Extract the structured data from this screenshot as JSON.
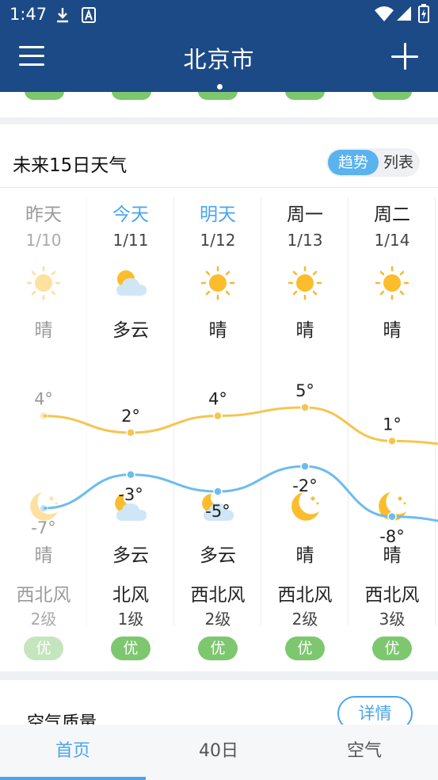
{
  "status_bar": {
    "time": "1:47"
  },
  "header": {
    "title": "北京市"
  },
  "forecast": {
    "title": "未来15日天气",
    "toggle": {
      "trend": "趋势",
      "list": "列表"
    },
    "days": [
      {
        "day": "昨天",
        "date": "1/10",
        "day_cond": "晴",
        "day_icon": "sun-icon",
        "high": "4°",
        "low": "-7°",
        "night_icon": "moon-icon",
        "night_cond": "晴",
        "wind": "西北风",
        "level": "2级",
        "aqi": "优"
      },
      {
        "day": "今天",
        "date": "1/11",
        "day_cond": "多云",
        "day_icon": "partly-cloudy-icon",
        "high": "2°",
        "low": "-3°",
        "night_icon": "partly-cloudy-night-icon",
        "night_cond": "多云",
        "wind": "北风",
        "level": "1级",
        "aqi": "优"
      },
      {
        "day": "明天",
        "date": "1/12",
        "day_cond": "晴",
        "day_icon": "sun-icon",
        "high": "4°",
        "low": "-5°",
        "night_icon": "partly-cloudy-night-icon",
        "night_cond": "多云",
        "wind": "西北风",
        "level": "2级",
        "aqi": "优"
      },
      {
        "day": "周一",
        "date": "1/13",
        "day_cond": "晴",
        "day_icon": "sun-icon",
        "high": "5°",
        "low": "-2°",
        "night_icon": "moon-icon",
        "night_cond": "晴",
        "wind": "西北风",
        "level": "2级",
        "aqi": "优"
      },
      {
        "day": "周二",
        "date": "1/14",
        "day_cond": "晴",
        "day_icon": "sun-icon",
        "high": "1°",
        "low": "-8°",
        "night_icon": "moon-icon",
        "night_cond": "晴",
        "wind": "西北风",
        "level": "3级",
        "aqi": "优"
      }
    ],
    "colors": {
      "high_line": "#f6c550",
      "low_line": "#6cbcf0",
      "aqi_good": "#7dc76e",
      "accent": "#4aa5ee"
    }
  },
  "air_quality": {
    "title": "空气质量",
    "detail_button": "详情"
  },
  "bottom_nav": {
    "tabs": [
      "首页",
      "40日",
      "空气"
    ],
    "active": "首页"
  }
}
